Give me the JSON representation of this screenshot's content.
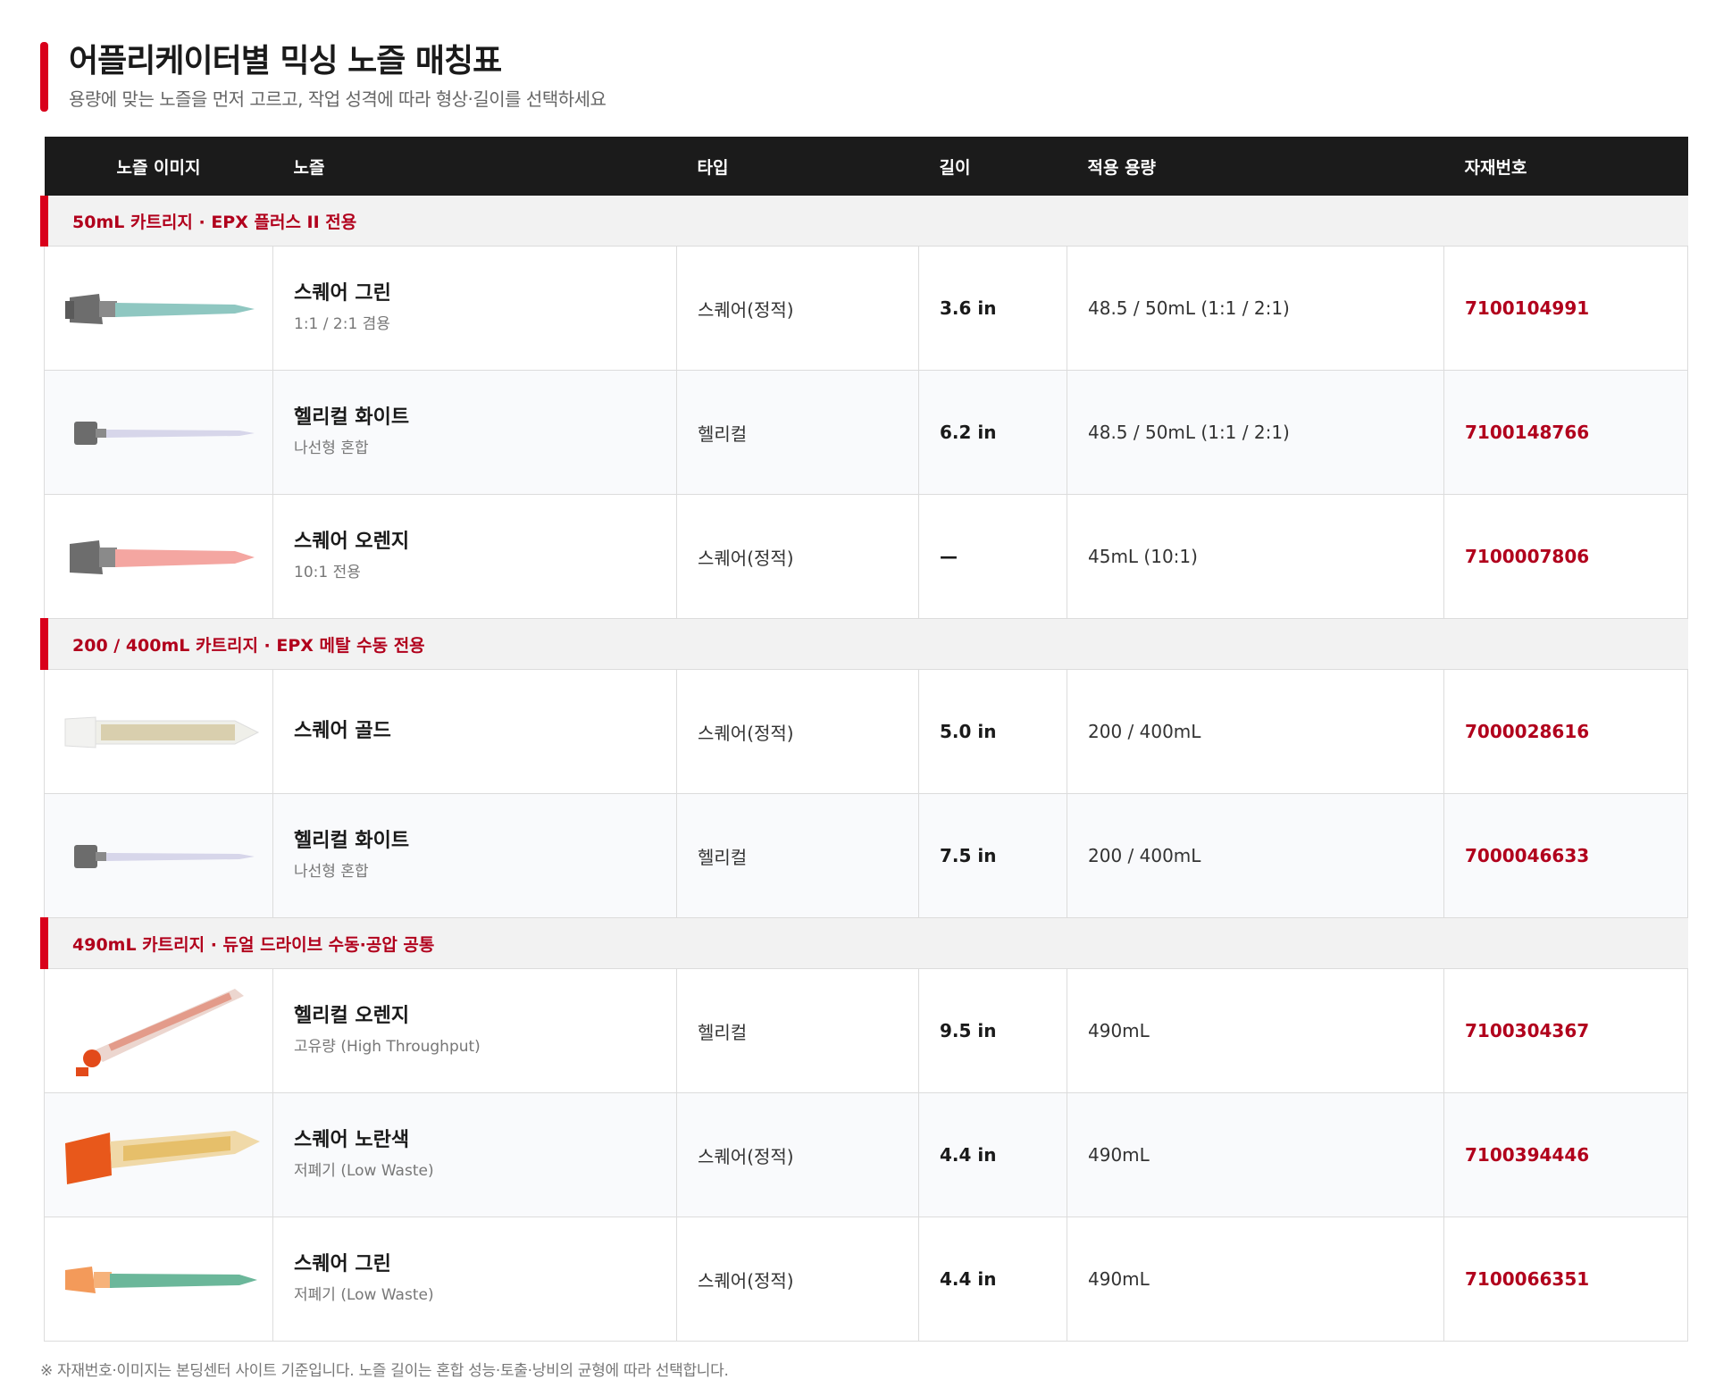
{
  "page": {
    "title": "어플리케이터별 믹싱 노즐 매칭표",
    "subtitle": "용량에 맞는 노즐을 먼저 고르고, 작업 성격에 따라 형상·길이를 선택하세요"
  },
  "table": {
    "headers": {
      "image": "노즐 이미지",
      "nozzle": "노즐",
      "type": "타입",
      "length": "길이",
      "capacity": "적용 용량",
      "part_no": "자재번호"
    },
    "groups": [
      {
        "label": "50mL 카트리지 · EPX 플러스 II 전용",
        "rows": [
          {
            "name": "스퀘어 그린",
            "sub": "1:1 / 2:1 겸용",
            "type": "스퀘어(정적)",
            "length": "3.6 in",
            "capacity": "48.5 / 50mL (1:1 / 2:1)",
            "part_no": "7100104991",
            "icon": "square-green-nozzle-icon"
          },
          {
            "name": "헬리컬 화이트",
            "sub": "나선형 혼합",
            "type": "헬리컬",
            "length": "6.2 in",
            "capacity": "48.5 / 50mL (1:1 / 2:1)",
            "part_no": "7100148766",
            "icon": "helical-white-nozzle-icon"
          },
          {
            "name": "스퀘어 오렌지",
            "sub": "10:1 전용",
            "type": "스퀘어(정적)",
            "length": "—",
            "capacity": "45mL (10:1)",
            "part_no": "7100007806",
            "icon": "square-orange-nozzle-icon"
          }
        ]
      },
      {
        "label": "200 / 400mL 카트리지 · EPX 메탈 수동 전용",
        "rows": [
          {
            "name": "스퀘어 골드",
            "sub": "",
            "type": "스퀘어(정적)",
            "length": "5.0 in",
            "capacity": "200 / 400mL",
            "part_no": "7000028616",
            "icon": "square-gold-nozzle-icon"
          },
          {
            "name": "헬리컬 화이트",
            "sub": "나선형 혼합",
            "type": "헬리컬",
            "length": "7.5 in",
            "capacity": "200 / 400mL",
            "part_no": "7000046633",
            "icon": "helical-white-nozzle-icon"
          }
        ]
      },
      {
        "label": "490mL 카트리지 · 듀얼 드라이브 수동·공압 공통",
        "rows": [
          {
            "name": "헬리컬 오렌지",
            "sub": "고유량 (High Throughput)",
            "type": "헬리컬",
            "length": "9.5 in",
            "capacity": "490mL",
            "part_no": "7100304367",
            "icon": "helical-orange-nozzle-icon"
          },
          {
            "name": "스퀘어 노란색",
            "sub": "저폐기 (Low Waste)",
            "type": "스퀘어(정적)",
            "length": "4.4 in",
            "capacity": "490mL",
            "part_no": "7100394446",
            "icon": "square-yellow-nozzle-icon"
          },
          {
            "name": "스퀘어 그린",
            "sub": "저폐기 (Low Waste)",
            "type": "스퀘어(정적)",
            "length": "4.4 in",
            "capacity": "490mL",
            "part_no": "7100066351",
            "icon": "square-green-nozzle-icon"
          }
        ]
      }
    ]
  },
  "note": "※ 자재번호·이미지는 본딩센터 사이트 기준입니다. 노즐 길이는 혼합 성능·토출·낭비의 균형에 따라 선택합니다.",
  "colors": {
    "accent": "#d9001b",
    "part_no": "#b1001c",
    "header_bg": "#1b1b1b"
  }
}
